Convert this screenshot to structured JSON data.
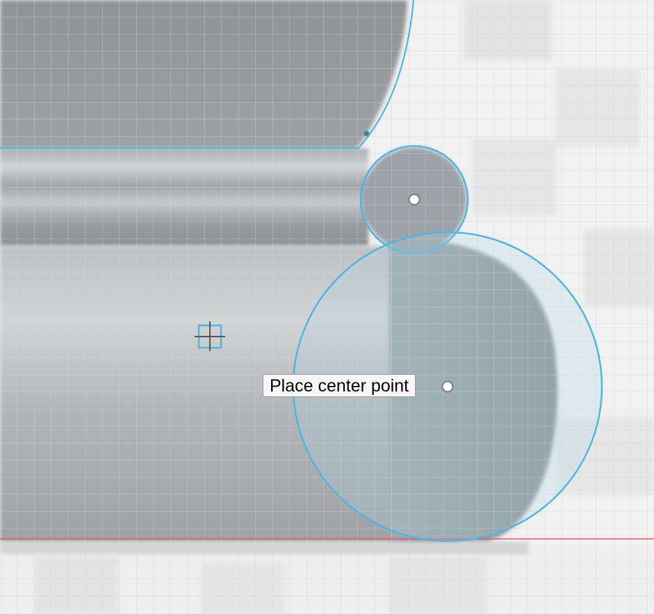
{
  "tooltip": {
    "text": "Place center point"
  },
  "colors": {
    "sketch_line": "#4fb6e4",
    "axis_red": "#e05a5a",
    "grid_line": "#cfcfcf",
    "grid_line_major": "#bdbdbd",
    "body_dark": "#8e9294",
    "body_light": "#b5b7b9",
    "background": "#f4f4f4"
  },
  "icons": {
    "origin": "origin-crosshair-icon",
    "center_point": "center-point-icon"
  }
}
